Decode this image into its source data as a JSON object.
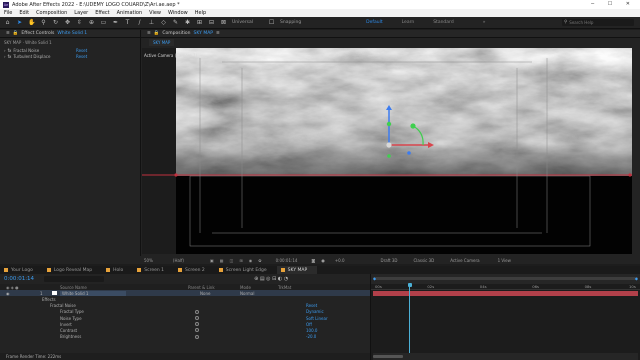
{
  "window": {
    "title": "Adobe After Effects 2022 - E:\\UDEMY LOGO COUARD\\Z\\Ari.ae.aep *"
  },
  "menu": [
    "File",
    "Edit",
    "Composition",
    "Layer",
    "Effect",
    "Animation",
    "View",
    "Window",
    "Help"
  ],
  "toolbar": {
    "universal": "Universal",
    "snapping": "Snapping",
    "workspaces": [
      "Default",
      "Learn",
      "Standard"
    ],
    "search_placeholder": "Search Help"
  },
  "effect_controls": {
    "tab_label": "Effect Controls",
    "layer": "White Solid 1",
    "breadcrumb": "SKY MAP · White Solid 1",
    "effects": [
      {
        "name": "Fractal Noise",
        "reset": "Reset"
      },
      {
        "name": "Turbulent Displace",
        "reset": "Reset"
      }
    ]
  },
  "composition": {
    "tab_label": "Composition",
    "comp_name": "SKY MAP",
    "flow_tab": "SKY MAP",
    "camera_label": "Active Camera (Camera 1)"
  },
  "viewer_status": {
    "zoom": "50%",
    "resolution": "(Half)",
    "time": "0:00:01:14",
    "exposure": "+0.0",
    "renderer": "Draft 3D",
    "renderer_mode": "Classic 3D",
    "camera": "Active Camera",
    "views": "1 View"
  },
  "timeline": {
    "tabs": [
      "Your Logo",
      "Logo Reveal Map",
      "Holo",
      "Screen 1",
      "Screen 2",
      "Screen Light Edge",
      "SKY MAP"
    ],
    "active_tab": "SKY MAP",
    "current_time": "0:00:01:14",
    "columns": {
      "source": "Source Name",
      "parent": "Parent & Link",
      "mode": "Mode",
      "trkmat": "TrkMat"
    },
    "layer": {
      "index": "1",
      "name": "White Solid 1",
      "parent": "None",
      "mode": "Normal"
    },
    "ruler_labels": [
      "00s",
      "02s",
      "04s",
      "06s",
      "08s",
      "10s"
    ],
    "props": [
      {
        "label": "Effects",
        "value": ""
      },
      {
        "label": "Fractal Noise",
        "value": "Reset"
      },
      {
        "label": "Fractal Type",
        "value": "Dynamic"
      },
      {
        "label": "Noise Type",
        "value": "Soft Linear"
      },
      {
        "label": "Invert",
        "value": "Off"
      },
      {
        "label": "Contrast",
        "value": "100.0"
      },
      {
        "label": "Brightness",
        "value": "-20.0"
      }
    ],
    "render_time": "Frame Render Time: 222ms",
    "playhead_fraction": 0.13
  },
  "colors": {
    "accent": "#2d8ceb",
    "layer_bar": "#b2404a",
    "orange_tab": "#e7a23a",
    "cyan_marker": "#4bb0d6"
  }
}
